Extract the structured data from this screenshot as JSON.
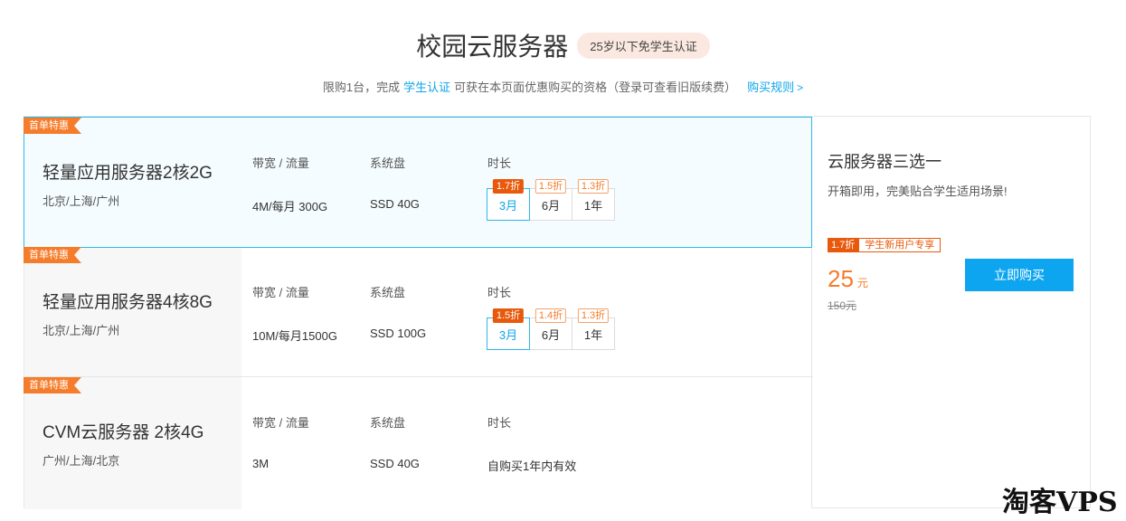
{
  "header": {
    "title": "校园云服务器",
    "badge": "25岁以下免学生认证",
    "subtitle_pre": "限购1台，完成",
    "subtitle_link": "学生认证",
    "subtitle_post": "可获在本页面优惠购买的资格（登录可查看旧版续费）",
    "rules_link": "购买规则",
    "rules_chevron": ">"
  },
  "labels": {
    "bandwidth": "带宽 / 流量",
    "disk": "系统盘",
    "duration": "时长"
  },
  "plans": [
    {
      "ribbon": "首单特惠",
      "name": "轻量应用服务器2核2G",
      "region": "北京/上海/广州",
      "bandwidth": "4M/每月 300G",
      "disk": "SSD 40G",
      "durations": [
        {
          "label": "3月",
          "discount": "1.7折",
          "selected": true
        },
        {
          "label": "6月",
          "discount": "1.5折",
          "selected": false
        },
        {
          "label": "1年",
          "discount": "1.3折",
          "selected": false
        }
      ]
    },
    {
      "ribbon": "首单特惠",
      "name": "轻量应用服务器4核8G",
      "region": "北京/上海/广州",
      "bandwidth": "10M/每月1500G",
      "disk": "SSD 100G",
      "durations": [
        {
          "label": "3月",
          "discount": "1.5折",
          "selected": true
        },
        {
          "label": "6月",
          "discount": "1.4折",
          "selected": false
        },
        {
          "label": "1年",
          "discount": "1.3折",
          "selected": false
        }
      ]
    },
    {
      "ribbon": "首单特惠",
      "name": "CVM云服务器 2核4G",
      "region": "广州/上海/北京",
      "bandwidth": "3M",
      "disk": "SSD 40G",
      "duration_text": "自购买1年内有效"
    }
  ],
  "side": {
    "title": "云服务器三选一",
    "desc": "开箱即用，完美贴合学生适用场景!",
    "promo_discount": "1.7折",
    "promo_tag": "学生新用户专享",
    "price": "25",
    "price_unit": "元",
    "original_price": "150元",
    "buy_label": "立即购买"
  },
  "watermark": "淘客VPS",
  "colors": {
    "accent": "#0ea5e9",
    "orange": "#f57c2a",
    "selected_border": "#2fb8e6"
  }
}
